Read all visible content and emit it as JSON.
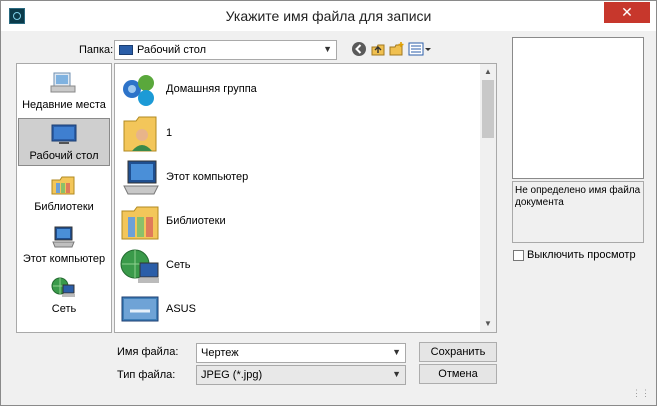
{
  "window": {
    "title": "Укажите имя файла для записи",
    "close": "✕"
  },
  "toolbar": {
    "folder_label": "Папка:",
    "folder_value": "Рабочий стол",
    "back_icon": "back-icon",
    "up_icon": "up-folder-icon",
    "new_folder_icon": "new-folder-icon",
    "view_icon": "view-menu-icon"
  },
  "places": [
    {
      "label": "Недавние места",
      "icon": "recent-places-icon"
    },
    {
      "label": "Рабочий стол",
      "icon": "desktop-icon",
      "selected": true
    },
    {
      "label": "Библиотеки",
      "icon": "libraries-icon"
    },
    {
      "label": "Этот компьютер",
      "icon": "computer-icon"
    },
    {
      "label": "Сеть",
      "icon": "network-icon"
    }
  ],
  "files": [
    {
      "name": "Домашняя группа",
      "icon": "homegroup-icon"
    },
    {
      "name": "1",
      "icon": "user-folder-icon"
    },
    {
      "name": "Этот компьютер",
      "icon": "computer-icon"
    },
    {
      "name": "Библиотеки",
      "icon": "libraries-icon"
    },
    {
      "name": "Сеть",
      "icon": "network-icon"
    },
    {
      "name": "ASUS",
      "icon": "asus-icon"
    }
  ],
  "form": {
    "filename_label": "Имя файла:",
    "filename_value": "Чертеж",
    "filetype_label": "Тип файла:",
    "filetype_value": "JPEG (*.jpg)",
    "save_label": "Сохранить",
    "cancel_label": "Отмена"
  },
  "preview": {
    "info": "Не определено имя файла документа",
    "disable_label": "Выключить просмотр"
  },
  "colors": {
    "close": "#c7372c",
    "folder_blue": "#2b5ea8",
    "folder_yellow": "#f3c65a"
  }
}
